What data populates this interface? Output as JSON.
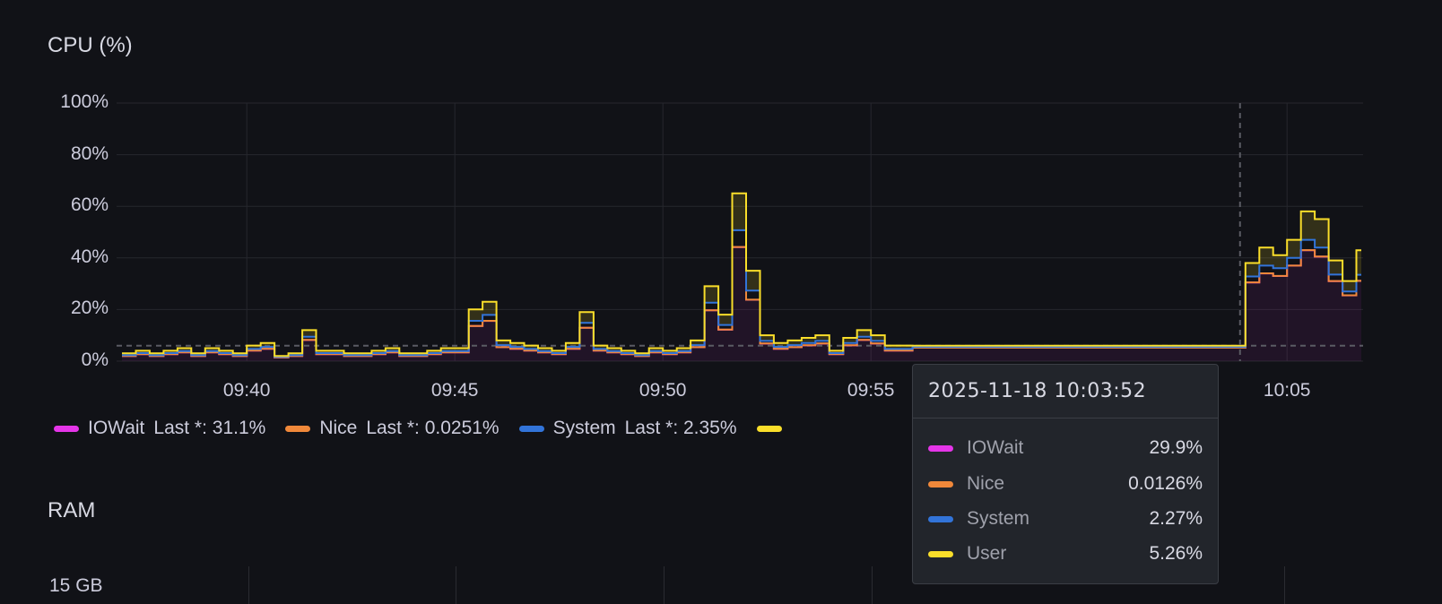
{
  "panels": {
    "cpu": {
      "title": "CPU (%)"
    },
    "ram": {
      "title": "RAM",
      "y_tick_top": "15 GB"
    }
  },
  "colors": {
    "iowait": "#e535e8",
    "nice": "#f0883a",
    "system": "#3274d9",
    "user": "#fade2a",
    "grid": "#26272d",
    "threshold": "#5a5b63"
  },
  "legend": [
    {
      "name": "IOWait",
      "stat": "Last *: 31.1%",
      "color_key": "iowait"
    },
    {
      "name": "Nice",
      "stat": "Last *: 0.0251%",
      "color_key": "nice"
    },
    {
      "name": "System",
      "stat": "Last *: 2.35%",
      "color_key": "system"
    },
    {
      "color_key": "user"
    }
  ],
  "tooltip": {
    "time": "2025-11-18 10:03:52",
    "rows": [
      {
        "name": "IOWait",
        "value": "29.9%",
        "color_key": "iowait"
      },
      {
        "name": "Nice",
        "value": "0.0126%",
        "color_key": "nice"
      },
      {
        "name": "System",
        "value": "2.27%",
        "color_key": "system"
      },
      {
        "name": "User",
        "value": "5.26%",
        "color_key": "user"
      }
    ]
  },
  "chart_data": {
    "type": "line",
    "stacked": true,
    "step": "after",
    "title": "CPU (%)",
    "x_start": "09:37:00",
    "x_interval_seconds": 20,
    "x_range_minutes": [
      0,
      30
    ],
    "x_ticks": [
      {
        "label": "09:40",
        "minute": 3
      },
      {
        "label": "09:45",
        "minute": 8
      },
      {
        "label": "09:50",
        "minute": 13
      },
      {
        "label": "09:55",
        "minute": 18
      },
      {
        "label": "10:05",
        "minute": 28
      }
    ],
    "y_ticks": [
      "0%",
      "20%",
      "40%",
      "60%",
      "80%",
      "100%"
    ],
    "ylim": [
      0,
      100
    ],
    "threshold": 6,
    "hover_minute": 26.87,
    "series": [
      {
        "name": "IOWait",
        "key": "iowait",
        "values": [
          2.0,
          2.7,
          2.0,
          2.7,
          3.4,
          2.0,
          3.4,
          2.7,
          2.0,
          4.1,
          4.8,
          1.4,
          2.0,
          8.2,
          2.7,
          2.7,
          2.0,
          2.0,
          2.7,
          3.4,
          2.0,
          2.0,
          2.7,
          3.4,
          3.4,
          13.6,
          15.6,
          5.4,
          4.8,
          4.1,
          3.4,
          2.7,
          4.8,
          12.9,
          4.1,
          3.4,
          2.7,
          2.0,
          3.4,
          2.7,
          3.4,
          5.4,
          19.7,
          12.2,
          44.2,
          23.8,
          6.8,
          4.8,
          5.4,
          6.1,
          6.8,
          2.7,
          6.1,
          8.2,
          6.8,
          4.1,
          4.1,
          5.2,
          5.2,
          5.2,
          5.2,
          5.2,
          5.2,
          5.2,
          5.2,
          5.2,
          5.2,
          5.2,
          5.2,
          5.2,
          5.2,
          5.2,
          5.2,
          5.2,
          5.2,
          5.2,
          5.2,
          5.2,
          5.2,
          5.2,
          5.2,
          30.5,
          34,
          33,
          37,
          43,
          40.5,
          31,
          25.5,
          31.1
        ]
      },
      {
        "name": "Nice",
        "key": "nice",
        "values": [
          0.03,
          0.03,
          0.03,
          0.03,
          0.03,
          0.03,
          0.03,
          0.03,
          0.03,
          0.03,
          0.03,
          0.03,
          0.03,
          0.03,
          0.03,
          0.03,
          0.03,
          0.03,
          0.03,
          0.03,
          0.03,
          0.03,
          0.03,
          0.03,
          0.03,
          0.03,
          0.03,
          0.03,
          0.03,
          0.03,
          0.03,
          0.03,
          0.03,
          0.03,
          0.03,
          0.03,
          0.03,
          0.03,
          0.03,
          0.03,
          0.03,
          0.03,
          0.03,
          0.03,
          0.03,
          0.03,
          0.03,
          0.03,
          0.03,
          0.03,
          0.03,
          0.03,
          0.03,
          0.03,
          0.03,
          0.03,
          0.03,
          0.01,
          0.01,
          0.01,
          0.01,
          0.01,
          0.01,
          0.01,
          0.01,
          0.01,
          0.01,
          0.01,
          0.01,
          0.01,
          0.01,
          0.01,
          0.01,
          0.01,
          0.01,
          0.01,
          0.01,
          0.01,
          0.01,
          0.01,
          0.01,
          0.0126,
          0.03,
          0.03,
          0.03,
          0.03,
          0.03,
          0.03,
          0.03,
          0.0251
        ]
      },
      {
        "name": "System",
        "key": "system",
        "values": [
          0.3,
          0.4,
          0.3,
          0.4,
          0.5,
          0.3,
          0.5,
          0.4,
          0.3,
          0.6,
          0.7,
          0.2,
          0.3,
          1.2,
          0.4,
          0.4,
          0.3,
          0.3,
          0.4,
          0.5,
          0.3,
          0.3,
          0.4,
          0.5,
          0.5,
          2.0,
          2.3,
          0.8,
          0.7,
          0.6,
          0.5,
          0.4,
          0.7,
          1.9,
          0.6,
          0.5,
          0.4,
          0.3,
          0.5,
          0.4,
          0.5,
          0.8,
          2.9,
          1.8,
          6.5,
          3.5,
          1.0,
          0.7,
          0.8,
          0.9,
          1.0,
          0.4,
          0.9,
          1.2,
          1.0,
          0.6,
          0.6,
          0.3,
          0.3,
          0.3,
          0.3,
          0.3,
          0.3,
          0.3,
          0.3,
          0.3,
          0.3,
          0.3,
          0.3,
          0.3,
          0.3,
          0.3,
          0.3,
          0.3,
          0.3,
          0.3,
          0.3,
          0.3,
          0.3,
          0.3,
          0.3,
          2.3,
          3,
          3,
          3,
          4,
          3.5,
          2.5,
          1.5,
          2.35
        ]
      },
      {
        "name": "User",
        "key": "user",
        "values": [
          0.7,
          0.9,
          0.7,
          0.9,
          1.1,
          0.7,
          1.1,
          0.9,
          0.7,
          1.3,
          1.5,
          0.4,
          0.7,
          2.6,
          0.9,
          0.9,
          0.7,
          0.7,
          0.9,
          1.1,
          0.7,
          0.7,
          0.9,
          1.1,
          1.1,
          4.4,
          5.1,
          1.8,
          1.5,
          1.3,
          1.1,
          0.9,
          1.5,
          4.2,
          1.3,
          1.1,
          0.9,
          0.7,
          1.1,
          0.9,
          1.1,
          1.8,
          6.4,
          4.0,
          14.3,
          7.7,
          2.2,
          1.5,
          1.8,
          2.0,
          2.2,
          0.9,
          2.0,
          2.6,
          2.2,
          1.3,
          1.3,
          0.5,
          0.5,
          0.5,
          0.5,
          0.5,
          0.5,
          0.5,
          0.5,
          0.5,
          0.5,
          0.5,
          0.5,
          0.5,
          0.5,
          0.5,
          0.5,
          0.5,
          0.5,
          0.5,
          0.5,
          0.5,
          0.5,
          0.5,
          0.5,
          5.2,
          7,
          5,
          7,
          11,
          11,
          5.5,
          4,
          9.5
        ]
      }
    ]
  }
}
